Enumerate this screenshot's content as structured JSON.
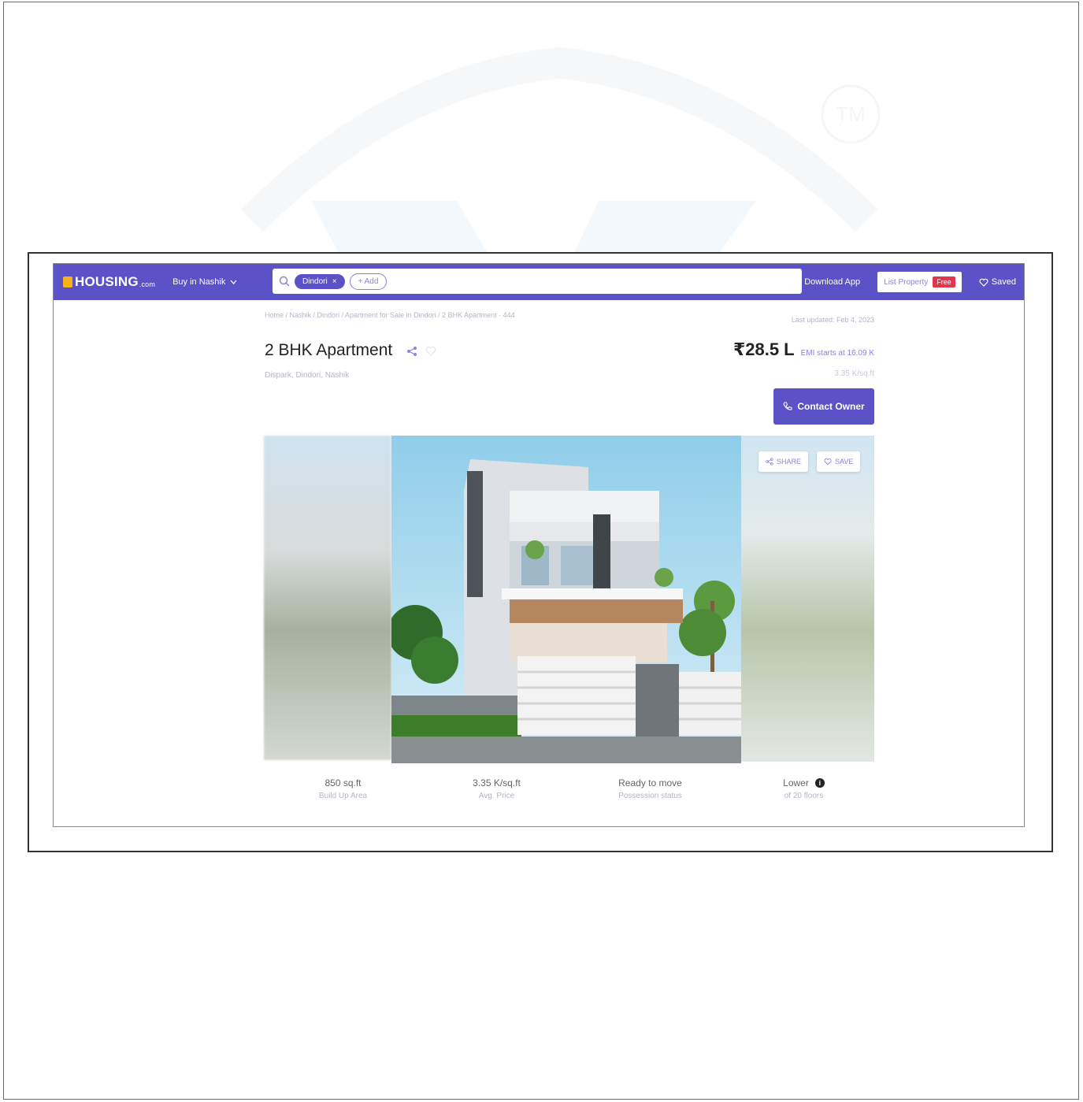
{
  "nav": {
    "logo_text": "HOUSING",
    "logo_suffix": ".com",
    "city_select": "Buy in Nashik",
    "search_chip": "Dindori",
    "add_chip": "+ Add",
    "download_app": "Download App",
    "list_property": "List Property",
    "free_badge": "Free",
    "saved": "Saved"
  },
  "breadcrumb": "Home / Nashik / Dindori / Apartment for Sale in Dindori / 2 BHK Apartment · 444",
  "last_updated": "Last updated: Feb 4, 2023",
  "title": "2 BHK Apartment",
  "locality": "Dispark, Dindori, Nashik",
  "price": "₹28.5 L",
  "emi": "EMI starts at 16.09 K",
  "price_per_sqft": "3.35 K/sq.ft",
  "contact_button": "Contact Owner",
  "gallery": {
    "share_label": "SHARE",
    "save_label": "SAVE"
  },
  "stats": [
    {
      "value": "850 sq.ft",
      "label": "Build Up Area"
    },
    {
      "value": "3.35 K/sq.ft",
      "label": "Avg. Price"
    },
    {
      "value": "Ready to move",
      "label": "Possession status"
    },
    {
      "value": "Lower",
      "label": "of 20 floors"
    }
  ],
  "watermark_text": "TM",
  "colors": {
    "brand": "#5a52c6",
    "accent": "#8a84d6",
    "free_badge": "#e2364f",
    "logo_mark": "#f6b21b"
  }
}
